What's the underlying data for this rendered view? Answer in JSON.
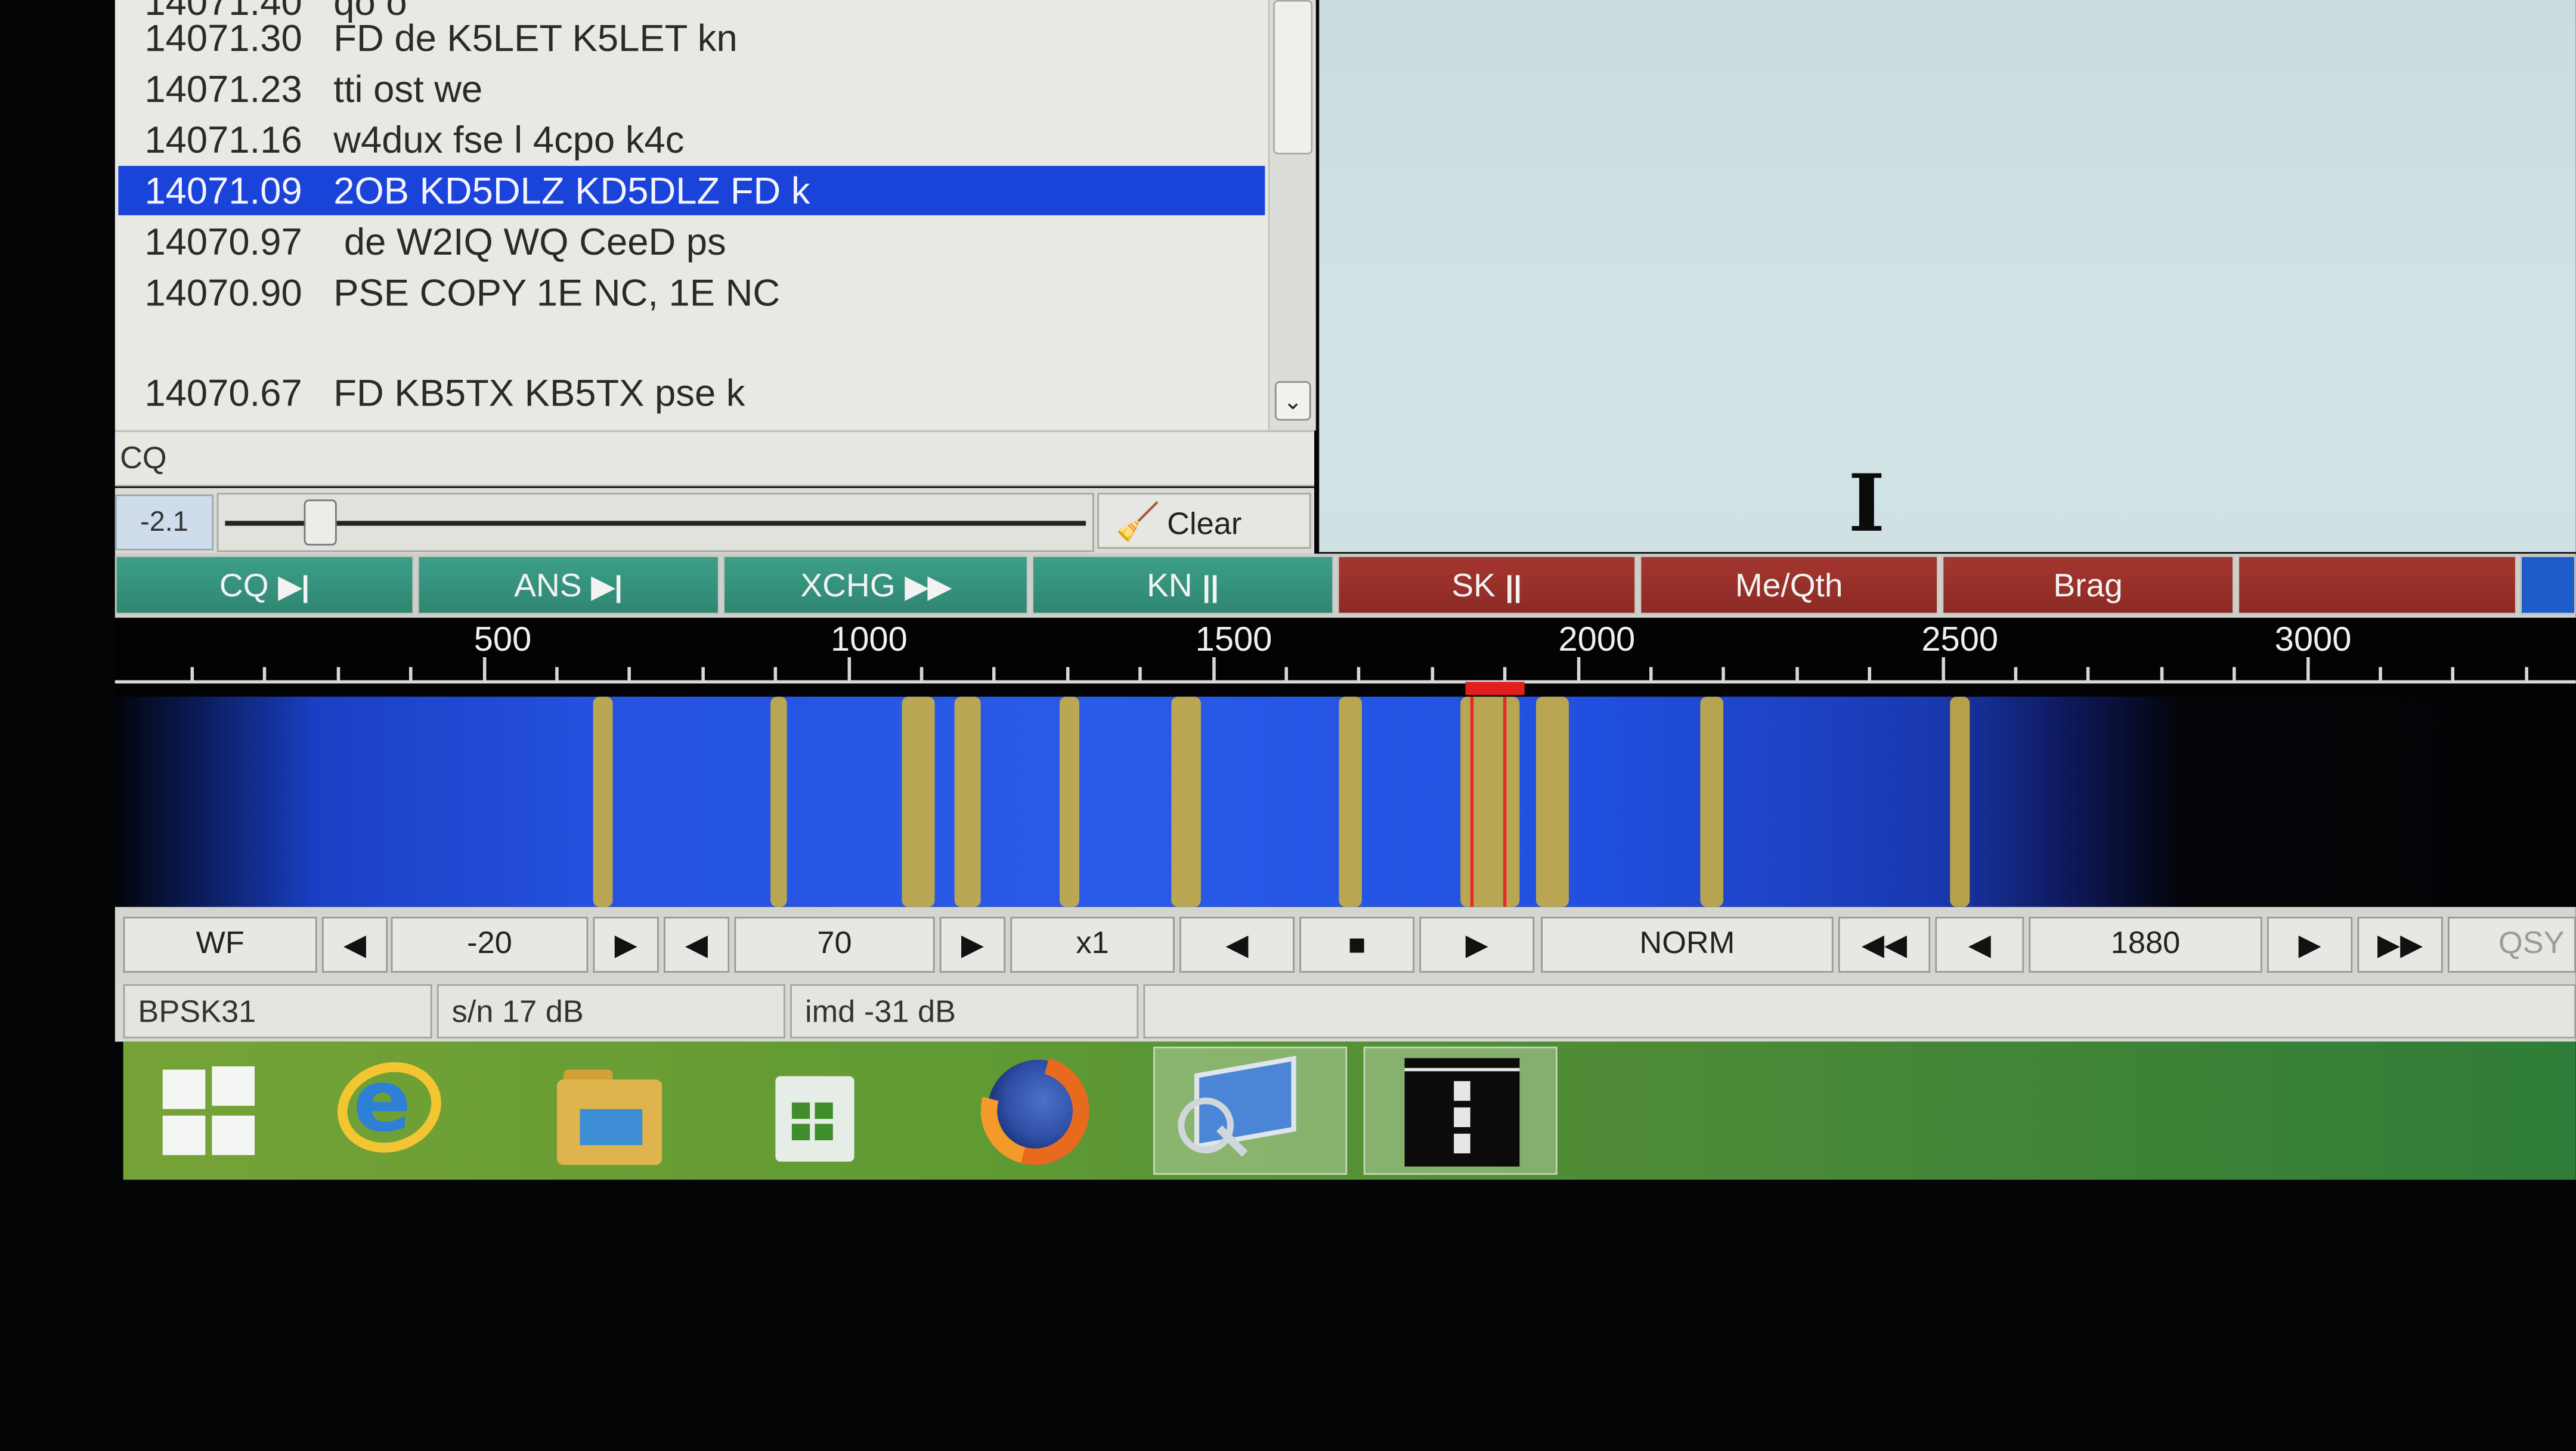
{
  "rx_list": {
    "rows": [
      {
        "freq": "14071.30",
        "text": "FD de K5LET K5LET kn",
        "selected": false
      },
      {
        "freq": "14071.23",
        "text": "tti  ost we",
        "selected": false
      },
      {
        "freq": "14071.16",
        "text": "w4dux fse l  4cpo  k4c",
        "selected": false
      },
      {
        "freq": "14071.09",
        "text": "2OB KD5DLZ KD5DLZ FD k",
        "selected": true
      },
      {
        "freq": "14070.97",
        "text": " de W2IQ WQ CeeD ps",
        "selected": false
      },
      {
        "freq": "14070.90",
        "text": "PSE COPY 1E NC, 1E NC",
        "selected": false
      },
      {
        "freq": "",
        "text": "",
        "selected": false
      },
      {
        "freq": "14070.67",
        "text": "FD KB5TX KB5TX pse k",
        "selected": false
      }
    ]
  },
  "tx_entry": {
    "text": "CQ"
  },
  "slider": {
    "value_label": "-2.1",
    "clear_label": "Clear"
  },
  "macros": [
    {
      "label": "CQ",
      "glyph": "▶|",
      "color": "green"
    },
    {
      "label": "ANS",
      "glyph": "▶|",
      "color": "green"
    },
    {
      "label": "XCHG",
      "glyph": "▶▶",
      "color": "green"
    },
    {
      "label": "KN",
      "glyph": "||",
      "color": "green"
    },
    {
      "label": "SK",
      "glyph": "||",
      "color": "red"
    },
    {
      "label": "Me/Qth",
      "glyph": "",
      "color": "red"
    },
    {
      "label": "Brag",
      "glyph": "",
      "color": "red"
    },
    {
      "label": "",
      "glyph": "",
      "color": "red"
    },
    {
      "label": "",
      "glyph": "",
      "color": "blue"
    }
  ],
  "scale": {
    "ticks": [
      "500",
      "1000",
      "1500",
      "2000",
      "2500",
      "3000"
    ]
  },
  "controls": {
    "wf_label": "WF",
    "ref_level": "-20",
    "range": "70",
    "zoom": "x1",
    "mode": "NORM",
    "carrier": "1880",
    "qsy": "QSY"
  },
  "status": {
    "modem": "BPSK31",
    "snr": "s/n 17 dB",
    "imd": "imd -31 dB"
  },
  "taskbar": {
    "items": [
      "windows-start",
      "internet-explorer",
      "file-explorer",
      "store",
      "firefox",
      "remote-desktop",
      "fldigi"
    ],
    "accent": "#5f9a33"
  }
}
